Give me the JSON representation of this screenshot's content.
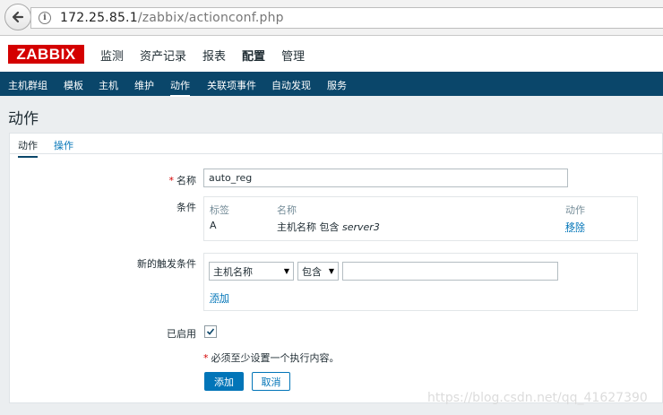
{
  "browser": {
    "url_host": "172.25.85.1",
    "url_path": "/zabbix/actionconf.php"
  },
  "header": {
    "logo": "ZABBIX",
    "nav": [
      "监测",
      "资产记录",
      "报表",
      "配置",
      "管理"
    ]
  },
  "subnav": [
    "主机群组",
    "模板",
    "主机",
    "维护",
    "动作",
    "关联项事件",
    "自动发现",
    "服务"
  ],
  "page": {
    "title": "动作",
    "tabs": [
      "动作",
      "操作"
    ]
  },
  "form": {
    "name_label": "名称",
    "name_value": "auto_reg",
    "conditions_label": "条件",
    "conditions_table": {
      "headers": [
        "标签",
        "名称",
        "动作"
      ],
      "rows": [
        {
          "tag": "A",
          "name_prefix": "主机名称 包含 ",
          "name_value": "server3",
          "action": "移除"
        }
      ]
    },
    "new_condition_label": "新的触发条件",
    "condition_type": "主机名称",
    "condition_operator": "包含",
    "condition_value": "",
    "add_link": "添加",
    "enabled_label": "已启用",
    "enabled": true,
    "warning": "必须至少设置一个执行内容。",
    "add_button": "添加",
    "cancel_button": "取消"
  },
  "watermark": "https://blog.csdn.net/qq_41627390"
}
